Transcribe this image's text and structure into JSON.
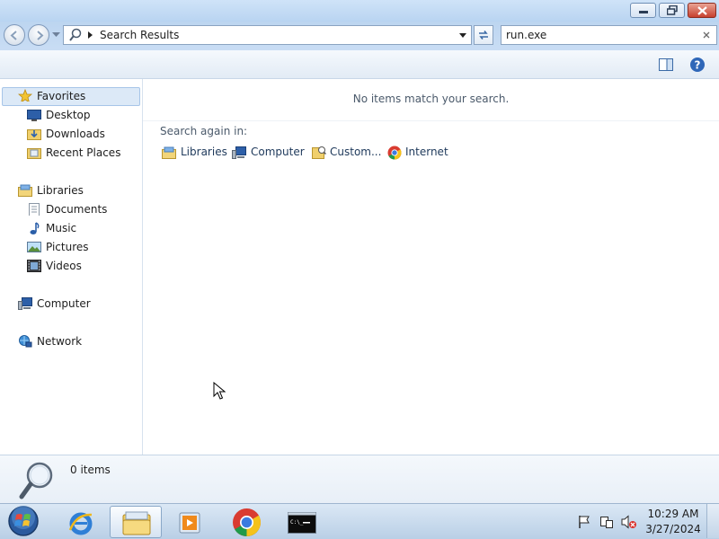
{
  "address": {
    "path": "Search Results"
  },
  "search": {
    "value": "run.exe"
  },
  "sidebar": {
    "favorites": {
      "label": "Favorites",
      "items": [
        {
          "label": "Desktop"
        },
        {
          "label": "Downloads"
        },
        {
          "label": "Recent Places"
        }
      ]
    },
    "libraries": {
      "label": "Libraries",
      "items": [
        {
          "label": "Documents"
        },
        {
          "label": "Music"
        },
        {
          "label": "Pictures"
        },
        {
          "label": "Videos"
        }
      ]
    },
    "computer": {
      "label": "Computer"
    },
    "network": {
      "label": "Network"
    }
  },
  "content": {
    "empty_message": "No items match your search.",
    "search_again_label": "Search again in:",
    "search_again_options": [
      {
        "label": "Libraries"
      },
      {
        "label": "Computer"
      },
      {
        "label": "Custom..."
      },
      {
        "label": "Internet"
      }
    ]
  },
  "details": {
    "count": "0 items"
  },
  "taskbar": {
    "time": "10:29 AM",
    "date": "3/27/2024"
  },
  "colors": {
    "selection": "#dce9f7",
    "accent": "#3a78c4",
    "link": "#1e395b"
  }
}
